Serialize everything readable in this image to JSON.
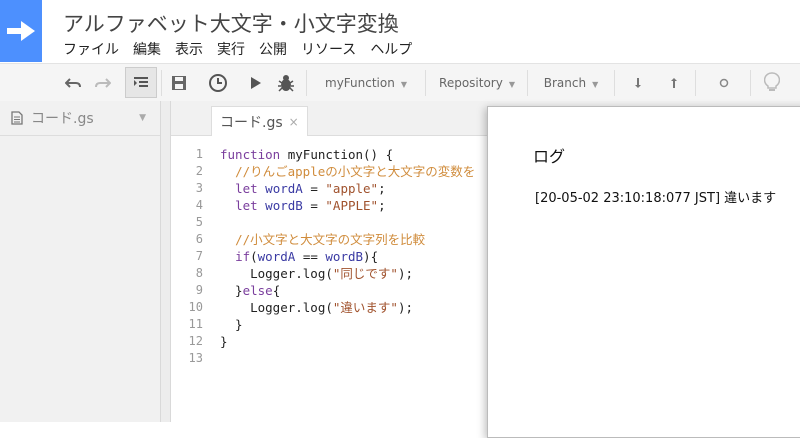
{
  "app": {
    "title": "アルファベット大文字・小文字変換",
    "accent_color": "#4d90fe"
  },
  "menu": [
    "ファイル",
    "編集",
    "表示",
    "実行",
    "公開",
    "リソース",
    "ヘルプ"
  ],
  "toolbar": {
    "function_select": "myFunction",
    "repository_label": "Repository",
    "branch_label": "Branch",
    "icons": [
      "undo-icon",
      "redo-icon",
      "indent-icon",
      "save-icon",
      "clock-icon",
      "run-icon",
      "debug-icon",
      "step-over-icon",
      "step-in-icon",
      "breakpoint-icon",
      "lightbulb-icon"
    ]
  },
  "sidebar": {
    "file_label": "コード.gs"
  },
  "editor": {
    "tab_label": "コード.gs",
    "tab_close": "×",
    "line_numbers": [
      "1",
      "2",
      "3",
      "4",
      "5",
      "6",
      "7",
      "8",
      "9",
      "10",
      "11",
      "12",
      "13"
    ],
    "lines": [
      "function myFunction() {",
      "  //りんごappleの小文字と大文字の変数を",
      "  let wordA = \"apple\";",
      "  let wordB = \"APPLE\";",
      "",
      "  //小文字と大文字の文字列を比較",
      "  if(wordA == wordB){",
      "    Logger.log(\"同じです\");",
      "  }else{",
      "    Logger.log(\"違います\");",
      "  }",
      "}",
      ""
    ]
  },
  "log": {
    "title": "ログ",
    "entry": "[20-05-02 23:10:18:077 JST] 違います"
  }
}
